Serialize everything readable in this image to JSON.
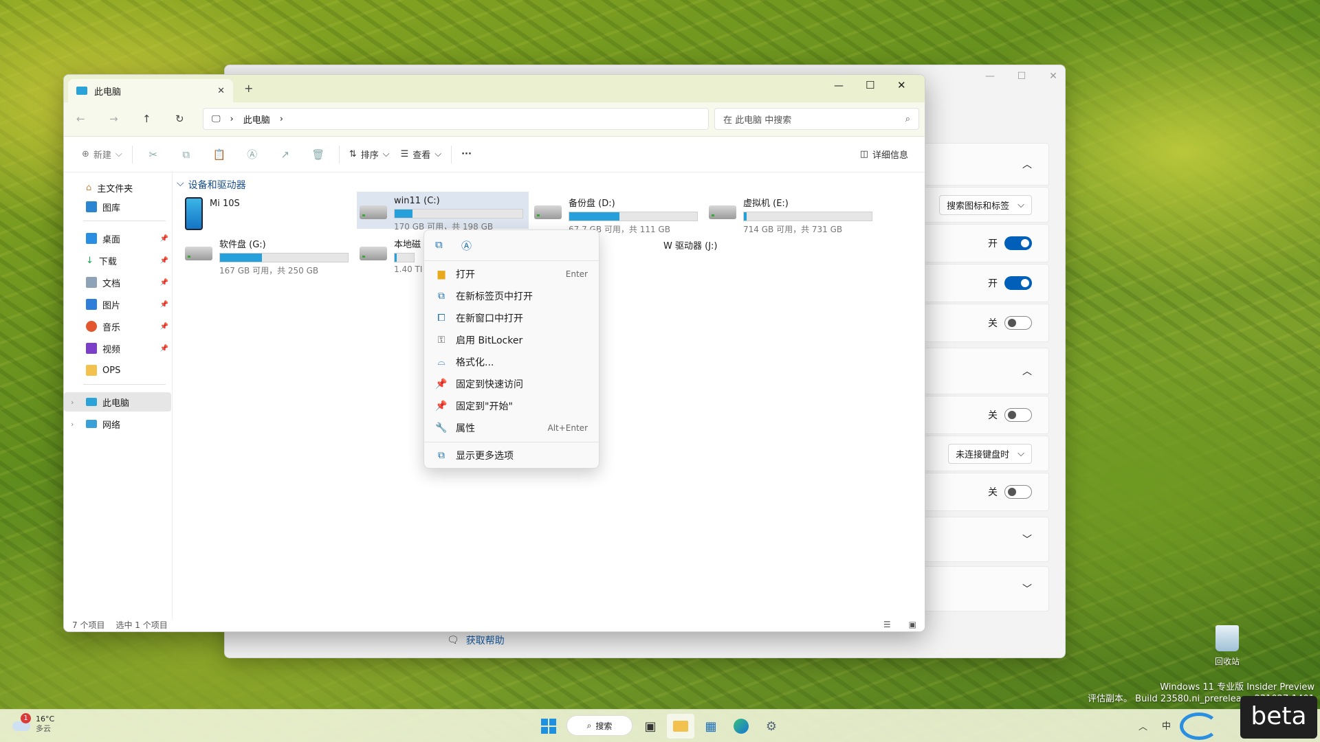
{
  "settings_window": {
    "rows": [
      {
        "type": "chevron",
        "label": "^"
      },
      {
        "type": "dropdown",
        "value": "搜索图标和标签"
      },
      {
        "type": "toggle",
        "state_text": "开",
        "on": true
      },
      {
        "type": "toggle",
        "state_text": "开",
        "on": true
      },
      {
        "type": "toggle",
        "state_text": "关",
        "on": false
      },
      {
        "type": "chevron",
        "label": "^"
      },
      {
        "type": "toggle",
        "state_text": "关",
        "on": false
      },
      {
        "type": "dropdown",
        "value": "未连接键盘时"
      },
      {
        "type": "toggle",
        "state_text": "关",
        "on": false
      },
      {
        "type": "chevron",
        "label": "v"
      },
      {
        "type": "chevron",
        "label": "v"
      }
    ],
    "help_link": "获取帮助"
  },
  "explorer": {
    "tab_title": "此电脑",
    "new_tab": "+",
    "breadcrumb": [
      "此电脑"
    ],
    "search_placeholder": "在 此电脑 中搜索",
    "toolbar": {
      "new_label": "新建",
      "sort_label": "排序",
      "view_label": "查看",
      "more_label": "···",
      "details_label": "详细信息"
    },
    "sidebar": {
      "home": "主文件夹",
      "gallery": "图库",
      "pinned": [
        "桌面",
        "下载",
        "文档",
        "图片",
        "音乐",
        "视频"
      ],
      "ops": "OPS",
      "this_pc": "此电脑",
      "network": "网络"
    },
    "section_title": "设备和驱动器",
    "phone": "Mi 10S",
    "drives": [
      {
        "name": "win11 (C:)",
        "info": "170 GB 可用，共 198 GB",
        "used_pct": 14
      },
      {
        "name": "备份盘 (D:)",
        "info": "67.7 GB 可用，共 111 GB",
        "used_pct": 39
      },
      {
        "name": "虚拟机 (E:)",
        "info": "714 GB 可用，共 731 GB",
        "used_pct": 2
      },
      {
        "name": "软件盘 (G:)",
        "info": "167 GB 可用，共 250 GB",
        "used_pct": 33
      },
      {
        "name": "本地磁",
        "info": "1.40 TI",
        "used_pct": 10
      }
    ],
    "dvd": "W 驱动器 (J:)",
    "status_items": "7 个项目",
    "status_selected": "选中 1 个项目"
  },
  "context_menu": {
    "items": [
      {
        "label": "打开",
        "accel": "Enter",
        "icon": "folder-icon"
      },
      {
        "label": "在新标签页中打开",
        "accel": "",
        "icon": "new-tab-icon"
      },
      {
        "label": "在新窗口中打开",
        "accel": "",
        "icon": "new-window-icon"
      },
      {
        "label": "启用 BitLocker",
        "accel": "",
        "icon": "key-icon"
      },
      {
        "label": "格式化...",
        "accel": "",
        "icon": "format-icon"
      },
      {
        "label": "固定到快速访问",
        "accel": "",
        "icon": "pin-icon"
      },
      {
        "label": "固定到\"开始\"",
        "accel": "",
        "icon": "pin-start-icon"
      },
      {
        "label": "属性",
        "accel": "Alt+Enter",
        "icon": "wrench-icon"
      },
      {
        "label": "显示更多选项",
        "accel": "",
        "icon": "more-options-icon"
      }
    ]
  },
  "desktop": {
    "recycle_bin": "回收站",
    "watermark_line1": "Windows 11 专业版 Insider Preview",
    "watermark_line2": "评估副本。 Build 23580.ni_prerelease.231027-1401"
  },
  "taskbar": {
    "weather_temp": "16°C",
    "weather_desc": "多云",
    "weather_badge": "1",
    "search_label": "搜索",
    "ime": "中",
    "logo_text": "beta"
  },
  "colors": {
    "accent": "#005fb8",
    "progress": "#26a0da",
    "selection": "#dde6f0"
  }
}
